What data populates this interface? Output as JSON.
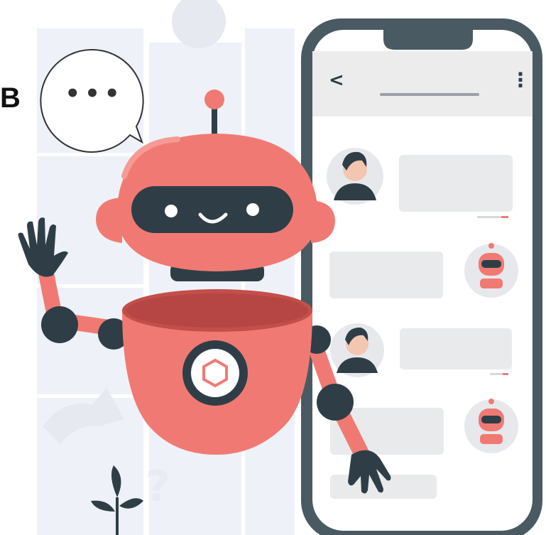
{
  "panel_label": "B",
  "speech_bubble": {
    "text": "•••"
  },
  "phone_header": {
    "back_glyph": "<",
    "menu_glyph": "⋮"
  },
  "decor": {
    "question_glyph": "?"
  },
  "colors": {
    "robot_coral": "#f07a73",
    "robot_dark": "#2f3e46",
    "phone_frame": "#4a5a63",
    "bubble_gray": "#e9eaec",
    "background_panels": "#eef1f8"
  },
  "icons": [
    "speech-bubble-icon",
    "robot-icon",
    "phone-icon",
    "person-avatar-icon",
    "robot-avatar-icon",
    "plant-icon",
    "question-mark-icon"
  ]
}
